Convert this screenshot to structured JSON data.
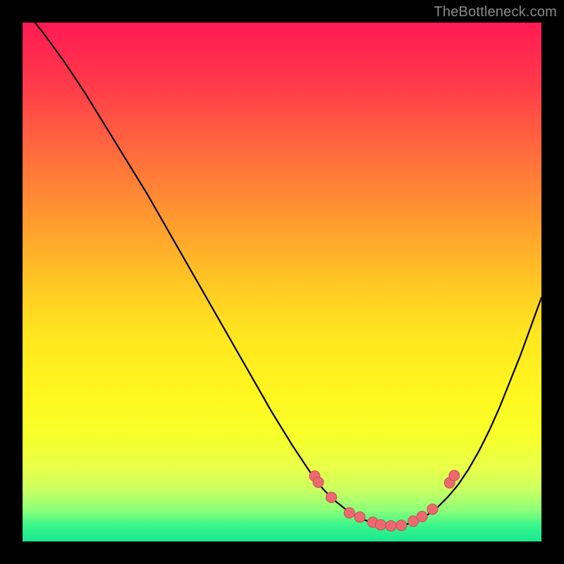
{
  "watermark": "TheBottleneck.com",
  "colors": {
    "frame": "#000000",
    "curve": "#000000",
    "marker_fill": "#ec6a6f",
    "marker_stroke": "#c94f55"
  },
  "chart_data": {
    "type": "line",
    "title": "",
    "xlabel": "",
    "ylabel": "",
    "xlim": [
      0,
      100
    ],
    "ylim": [
      0,
      100
    ],
    "grid": false,
    "series": [
      {
        "name": "bottleneck-curve",
        "x": [
          0,
          4,
          8,
          12,
          16,
          20,
          24,
          28,
          32,
          36,
          40,
          44,
          48,
          52,
          56,
          58,
          60,
          62,
          64,
          66,
          68,
          70,
          72,
          74,
          76,
          78,
          80,
          82,
          84,
          86,
          88,
          90,
          92,
          96,
          100
        ],
        "y": [
          103,
          98,
          92.5,
          86.5,
          80,
          73.5,
          67,
          60,
          53,
          46,
          39,
          32,
          25,
          18.5,
          12.5,
          10,
          8,
          6.4,
          5.1,
          4.1,
          3.4,
          3,
          3,
          3.3,
          4,
          5.1,
          6.6,
          8.6,
          11,
          14,
          17.5,
          21.5,
          26,
          36,
          47
        ]
      }
    ],
    "markers": {
      "name": "highlighted-points",
      "x": [
        56.3,
        57.0,
        59.5,
        63.0,
        65.0,
        67.5,
        69.0,
        71.0,
        73.0,
        75.3,
        77.0,
        79.0,
        82.3,
        83.2
      ],
      "y": [
        12.6,
        11.4,
        8.5,
        5.5,
        4.7,
        3.7,
        3.2,
        3.0,
        3.1,
        3.9,
        4.8,
        6.2,
        11.3,
        12.7
      ]
    }
  }
}
